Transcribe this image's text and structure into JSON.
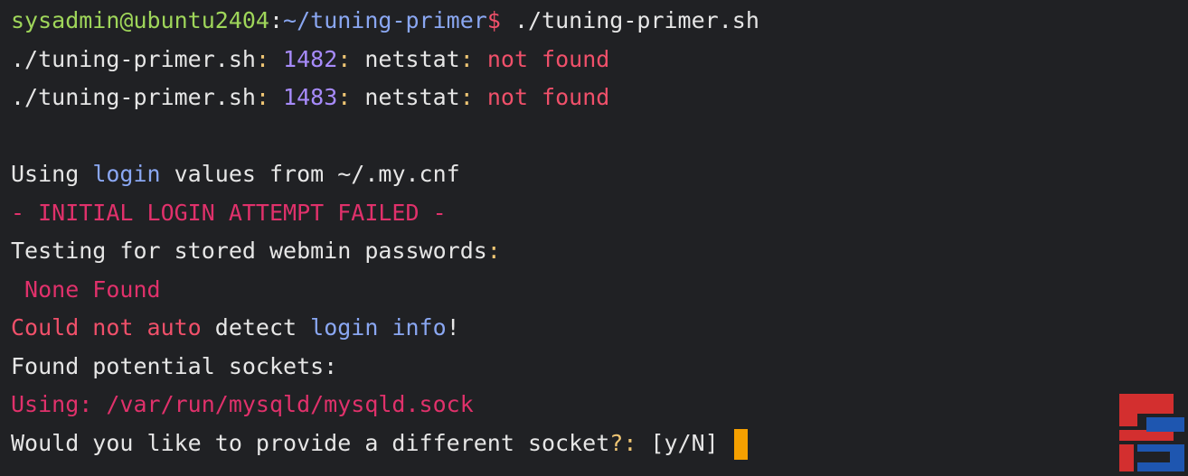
{
  "terminal": {
    "lines": [
      {
        "user_host": "sysadmin@ubuntu2404",
        "sep": ":",
        "path": "~/tuning-primer",
        "prompt": "$",
        "command": " ./tuning-primer.sh"
      },
      {
        "script": "./tuning-primer.sh",
        "c1": ": ",
        "lineno": "1482",
        "c2": ": ",
        "cmd": "netstat",
        "c3": ": ",
        "err": "not found"
      },
      {
        "script": "./tuning-primer.sh",
        "c1": ": ",
        "lineno": "1483",
        "c2": ": ",
        "cmd": "netstat",
        "c3": ": ",
        "err": "not found"
      },
      {},
      {
        "t1": "Using ",
        "t2": "login",
        "t3": " values from ~/.my.cnf"
      },
      {
        "text": "- INITIAL LOGIN ATTEMPT FAILED -"
      },
      {
        "t1": "Testing for stored webmin passwords",
        "t2": ":"
      },
      {
        "text": " None Found"
      },
      {
        "t1": "Could not auto",
        "t2": " detect ",
        "t3": "login info",
        "t4": "!"
      },
      {
        "text": "Found potential sockets:"
      },
      {
        "text": "Using: /var/run/mysqld/mysqld.sock"
      },
      {
        "t1": "Would you like to provide a different socket",
        "t2": "?:",
        "t3": " [y/N] "
      }
    ]
  },
  "colors": {
    "background": "#202124",
    "prompt_green": "#9fd65a",
    "path_blue": "#8aa7f2",
    "number_purple": "#a78bfa",
    "error_red": "#f0506a",
    "warning_pink": "#e0316b",
    "cursor_orange": "#f5a000",
    "logo_red": "#d32f2f",
    "logo_blue": "#1e56b0"
  },
  "logo": {
    "name": "sb-logo-watermark"
  }
}
